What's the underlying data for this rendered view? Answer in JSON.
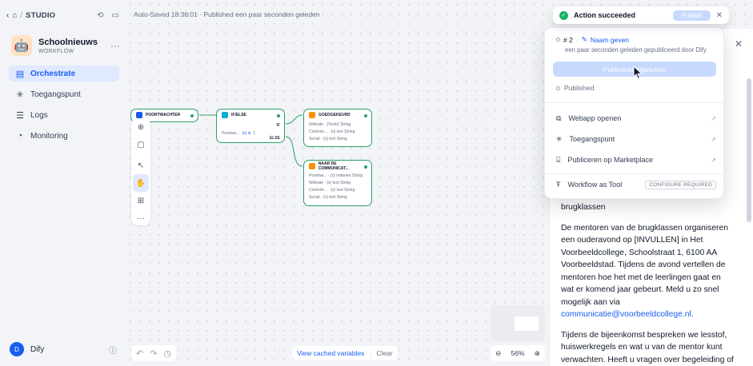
{
  "sidebar": {
    "studio_label": "STUDIO",
    "app": {
      "name": "Schoolnieuws",
      "type": "WORKFLOW",
      "icon": "🤖"
    },
    "nav": [
      {
        "label": "Orchestrate",
        "icon": "orchestrate-icon",
        "active": true
      },
      {
        "label": "Toegangspunt",
        "icon": "access-point-icon",
        "active": false
      },
      {
        "label": "Logs",
        "icon": "logs-icon",
        "active": false
      },
      {
        "label": "Monitoring",
        "icon": "monitoring-icon",
        "active": false
      }
    ],
    "user": {
      "initial": "D",
      "name": "Dify"
    }
  },
  "header": {
    "autosave_text": "Auto-Saved 18:36:01 · Published een paar seconden geleden"
  },
  "nodes": {
    "start": {
      "title": "POORTWACHTER"
    },
    "ifelse": {
      "title": "IF/ELSE",
      "if_label": "IF",
      "else_label": "ELSE",
      "condition": "Poortwa...",
      "cond_op": "{x} is",
      "cond_val": "1"
    },
    "rejected": {
      "title": "GOEDGEKEURD",
      "rows": [
        "Website · {Texto} String",
        "Controle... · {x} text String",
        "Social · {x} text String"
      ]
    },
    "comm": {
      "title": "NAAR DE COMMUNICAT...",
      "rows": [
        "Poortwa... · {x} redenen String",
        "Website · {x} text String",
        "Controle... · {x} text String",
        "Social · {x} text String"
      ]
    }
  },
  "canvas": {
    "cached_link": "View cached variables",
    "clear": "Clear",
    "zoom": "56%"
  },
  "toast": {
    "message": "Action succeeded",
    "publish_label": "Publish"
  },
  "publish_menu": {
    "version": "# 2",
    "name_label": "Naam geven",
    "subtitle": "een paar seconden geleden gepubliceerd door Dify",
    "update_button": "Publiceren bijwerken",
    "state": "Published",
    "items": [
      {
        "label": "Webapp openen",
        "icon": "webapp-icon"
      },
      {
        "label": "Toegangspunt",
        "icon": "access-point-icon"
      },
      {
        "label": "Publiceren op Marketplace",
        "icon": "marketplace-icon"
      }
    ],
    "tool_item": {
      "label": "Workflow as Tool",
      "badge": "CONFIGURE REQUIRED"
    }
  },
  "preview": {
    "heading_tail": "brugklassen",
    "para1": "De mentoren van de brugklassen organiseren een ouderavond op [INVULLEN] in Het Voorbeeldcollege, Schoolstraat 1, 6100 AA Voorbeeldstad. Tijdens de avond vertellen de mentoren hoe het met de leerlingen gaat en wat er komend jaar gebeurt. Meld u zo snel mogelijk aan via",
    "email": "communicatie@voorbeeldcollege.nl",
    "para2": "Tijdens de bijeenkomst bespreken we lesstof, huiswerkregels en wat u van de mentor kunt verwachten. Heeft u vragen over begeleiding of"
  },
  "colors": {
    "accent": "#155eef",
    "success": "#17b26a",
    "node_border": "#2e9e6b"
  }
}
